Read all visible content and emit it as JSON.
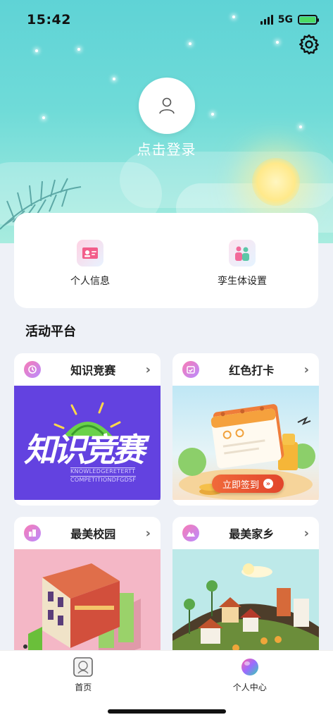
{
  "status_bar": {
    "time": "15:42",
    "network": "5G"
  },
  "profile": {
    "login_label": "点击登录"
  },
  "quick_links": [
    {
      "label": "个人信息",
      "icon": "id-card-icon"
    },
    {
      "label": "孪生体设置",
      "icon": "twin-people-icon"
    }
  ],
  "section": {
    "title": "活动平台"
  },
  "cards": [
    {
      "title": "知识竞赛",
      "icon": "quiz-icon",
      "banner": {
        "main": "知识竞赛",
        "line1": "KNOWLEDGERETERTT",
        "line2": "COMPETITIONDFGDSF"
      }
    },
    {
      "title": "红色打卡",
      "icon": "calendar-check-icon",
      "banner": {
        "button": "立即签到"
      }
    },
    {
      "title": "最美校园",
      "icon": "building-icon"
    },
    {
      "title": "最美家乡",
      "icon": "mountain-icon"
    }
  ],
  "tabbar": [
    {
      "label": "首页",
      "icon": "home-icon"
    },
    {
      "label": "个人中心",
      "icon": "profile-orb-icon"
    }
  ],
  "colors": {
    "sky": "#5fd3d6",
    "knowledge_bg": "#6342e0",
    "checkin_button": "#e2452c"
  }
}
